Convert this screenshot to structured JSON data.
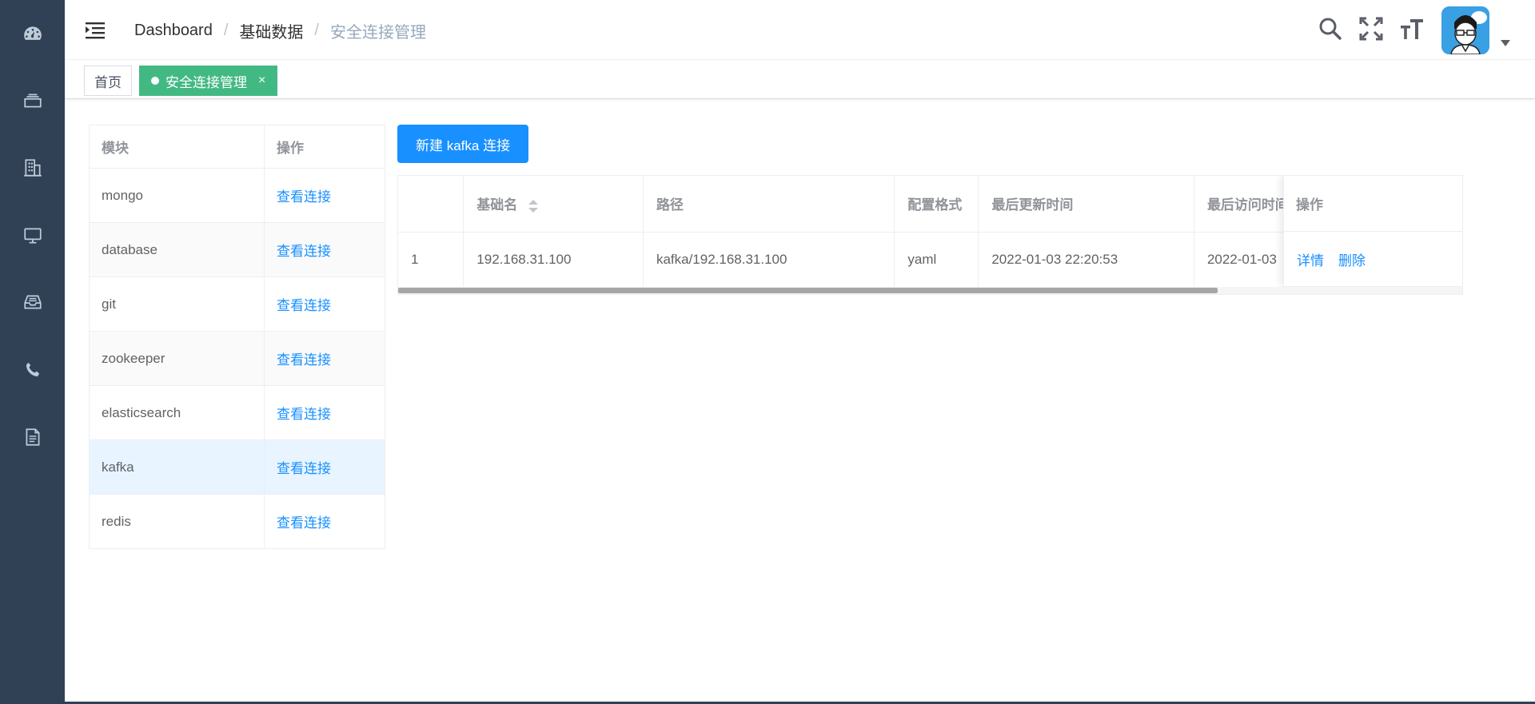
{
  "sidebar": {
    "items": [
      {
        "icon": "dashboard-icon"
      },
      {
        "icon": "stack-icon"
      },
      {
        "icon": "building-icon"
      },
      {
        "icon": "monitor-icon"
      },
      {
        "icon": "inbox-icon"
      },
      {
        "icon": "phone-icon"
      },
      {
        "icon": "document-icon"
      }
    ],
    "background": "#304156"
  },
  "navbar": {
    "breadcrumb": [
      "Dashboard",
      "基础数据",
      "安全连接管理"
    ],
    "separator": "/",
    "icons": [
      "search-icon",
      "fullscreen-icon",
      "font-size-icon"
    ],
    "avatar": "avatar"
  },
  "tags": {
    "home": "首页",
    "active": "安全连接管理",
    "close": "×",
    "active_color": "#42b983"
  },
  "modules": {
    "headers": [
      "模块",
      "操作"
    ],
    "rows": [
      {
        "name": "mongo",
        "action": "查看连接"
      },
      {
        "name": "database",
        "action": "查看连接"
      },
      {
        "name": "git",
        "action": "查看连接"
      },
      {
        "name": "zookeeper",
        "action": "查看连接"
      },
      {
        "name": "elasticsearch",
        "action": "查看连接"
      },
      {
        "name": "kafka",
        "action": "查看连接"
      },
      {
        "name": "redis",
        "action": "查看连接"
      }
    ],
    "selected": "kafka"
  },
  "main": {
    "new_button": "新建 kafka 连接",
    "primary_color": "#1890ff",
    "table": {
      "headers": [
        "",
        "基础名",
        "路径",
        "配置格式",
        "最后更新时间",
        "最后访问时间",
        "操作"
      ],
      "rows": [
        {
          "index": "1",
          "name": "192.168.31.100",
          "path": "kafka/192.168.31.100",
          "format": "yaml",
          "updated": "2022-01-03 22:20:53",
          "accessed": "2022-01-03",
          "actions": [
            "详情",
            "删除"
          ]
        }
      ]
    }
  }
}
